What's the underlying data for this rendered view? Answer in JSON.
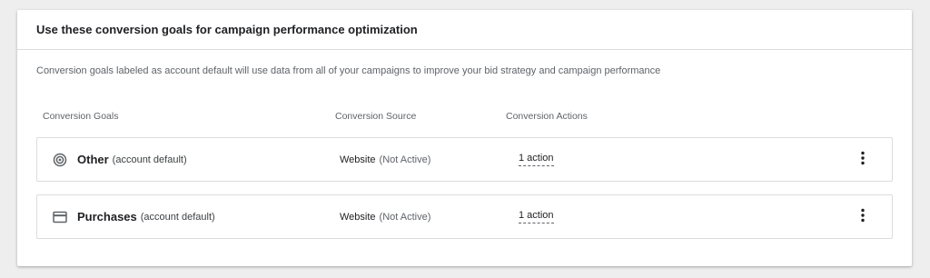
{
  "card": {
    "title": "Use these conversion goals for campaign performance optimization",
    "description": "Conversion goals labeled as account default will use data from all of your campaigns to improve your bid strategy and campaign performance"
  },
  "columns": {
    "goals": "Conversion Goals",
    "source": "Conversion Source",
    "actions": "Conversion Actions"
  },
  "goals": [
    {
      "icon": "target-icon",
      "name": "Other",
      "suffix": "(account default)",
      "source_name": "Website",
      "source_status": "(Not Active)",
      "actions": "1 action"
    },
    {
      "icon": "credit-card-icon",
      "name": "Purchases",
      "suffix": "(account default)",
      "source_name": "Website",
      "source_status": "(Not Active)",
      "actions": "1 action"
    }
  ],
  "colors": {
    "page_background": "#eeeeef",
    "card_background": "#ffffff",
    "border": "#dadce0",
    "secondary_text": "#5f6368"
  }
}
